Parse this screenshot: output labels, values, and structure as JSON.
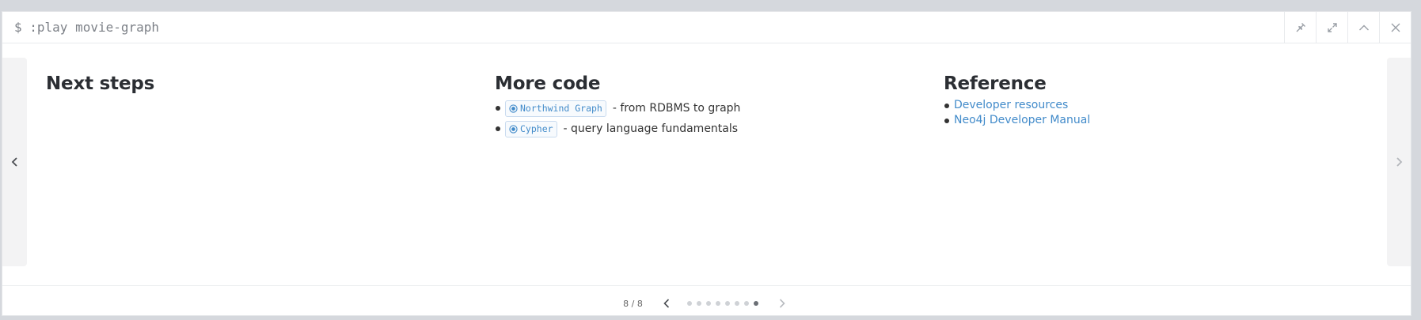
{
  "titlebar": {
    "command": "$ :play movie-graph",
    "actions": [
      {
        "name": "pin-button",
        "icon": "pin-icon"
      },
      {
        "name": "expand-button",
        "icon": "expand-icon"
      },
      {
        "name": "collapse-button",
        "icon": "chevron-up-icon"
      },
      {
        "name": "close-button",
        "icon": "close-icon"
      }
    ]
  },
  "slide": {
    "col1": {
      "heading": "Next steps"
    },
    "col2": {
      "heading": "More code",
      "items": [
        {
          "chip": "Northwind Graph",
          "desc": "- from RDBMS to graph"
        },
        {
          "chip": "Cypher",
          "desc": "- query language fundamentals"
        }
      ]
    },
    "col3": {
      "heading": "Reference",
      "links": [
        "Developer resources",
        "Neo4j Developer Manual"
      ]
    }
  },
  "pager": {
    "count": "8 / 8",
    "current": 8,
    "total": 8
  },
  "colors": {
    "link": "#428bca",
    "heading": "#2b2e33",
    "nav_strip": "#f3f3f4"
  }
}
